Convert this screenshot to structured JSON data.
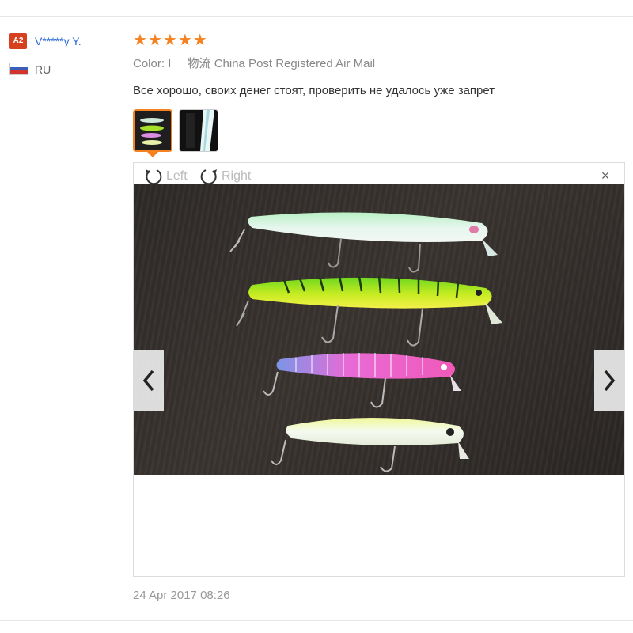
{
  "reviewer": {
    "level_badge": "A2",
    "name": "V*****y Y.",
    "country": "RU"
  },
  "review": {
    "stars": 5,
    "color_label": "Color:",
    "color_value": "I",
    "logistics": "物流 China Post Registered Air Mail",
    "text": "Все хорошо, своих денег стоят, проверить не удалось уже запрет",
    "date": "24 Apr 2017 08:26"
  },
  "viewer": {
    "rotate_left": "Left",
    "rotate_right": "Right",
    "close": "×"
  },
  "icons": {
    "rotate_left": "rotate-left-icon",
    "rotate_right": "rotate-right-icon",
    "prev": "chevron-left-icon",
    "next": "chevron-right-icon",
    "close": "close-icon",
    "star": "star-icon"
  },
  "colors": {
    "badge": "#d6401e",
    "username": "#2a6ad7",
    "stars": "#f58220"
  }
}
